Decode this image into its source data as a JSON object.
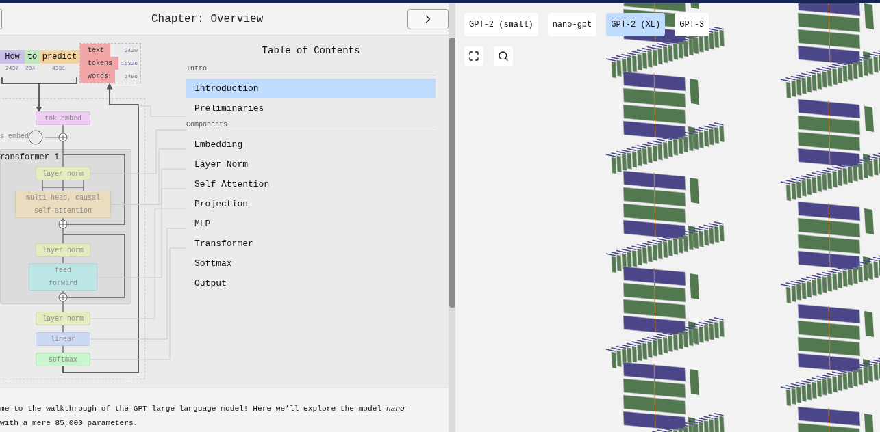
{
  "header": {
    "title": "Chapter: Overview"
  },
  "diagram": {
    "tokens": [
      {
        "text": "How",
        "count": "2437",
        "color": "#c9bfe8"
      },
      {
        "text": "to",
        "count": "284",
        "color": "#bfe6bf"
      },
      {
        "text": "predict",
        "count": "4331",
        "color": "#f2d3a4"
      }
    ],
    "legend": [
      {
        "label": "text",
        "count": "2420",
        "level": 0.5
      },
      {
        "label": "tokens",
        "count": "16326",
        "level": 0.64
      },
      {
        "label": "words",
        "count": "2456",
        "level": 0.58
      }
    ],
    "pos_embed_label": "s embed",
    "block_label": "ransformer i",
    "nodes": [
      {
        "lines": [
          "tok embed"
        ],
        "color": "#f0cdf5"
      },
      {
        "lines": [
          "layer norm"
        ],
        "color": "#e6eabf"
      },
      {
        "lines": [
          "multi-head, causal",
          "self-attention"
        ],
        "color": "#e9dcbf"
      },
      {
        "lines": [
          "layer norm"
        ],
        "color": "#e6eabf"
      },
      {
        "lines": [
          "feed",
          "forward"
        ],
        "color": "#bde6e6"
      },
      {
        "lines": [
          "layer norm"
        ],
        "color": "#e6eabf"
      },
      {
        "lines": [
          "linear"
        ],
        "color": "#cbd9f3"
      },
      {
        "lines": [
          "softmax"
        ],
        "color": "#c9f5cd"
      }
    ]
  },
  "toc": {
    "title": "Table of Contents",
    "sections": [
      {
        "heading": "Intro",
        "items": [
          {
            "label": "Introduction",
            "selected": true
          },
          {
            "label": "Preliminaries",
            "selected": false
          }
        ]
      },
      {
        "heading": "Components",
        "items": [
          {
            "label": "Embedding",
            "selected": false
          },
          {
            "label": "Layer Norm",
            "selected": false
          },
          {
            "label": "Self Attention",
            "selected": false
          },
          {
            "label": "Projection",
            "selected": false
          },
          {
            "label": "MLP",
            "selected": false
          },
          {
            "label": "Transformer",
            "selected": false
          },
          {
            "label": "Softmax",
            "selected": false
          },
          {
            "label": "Output",
            "selected": false
          }
        ]
      }
    ]
  },
  "intro_text": {
    "lines": [
      "me to the walkthrough of the GPT large language model! Here we’ll explore the model *nano-*",
      "with a mere 85,000 parameters."
    ]
  },
  "viewer": {
    "models": [
      {
        "label": "GPT-2 (small)",
        "selected": false
      },
      {
        "label": "nano-gpt",
        "selected": false
      },
      {
        "label": "GPT-2 (XL)",
        "selected": true
      },
      {
        "label": "GPT-3",
        "selected": false
      }
    ]
  }
}
